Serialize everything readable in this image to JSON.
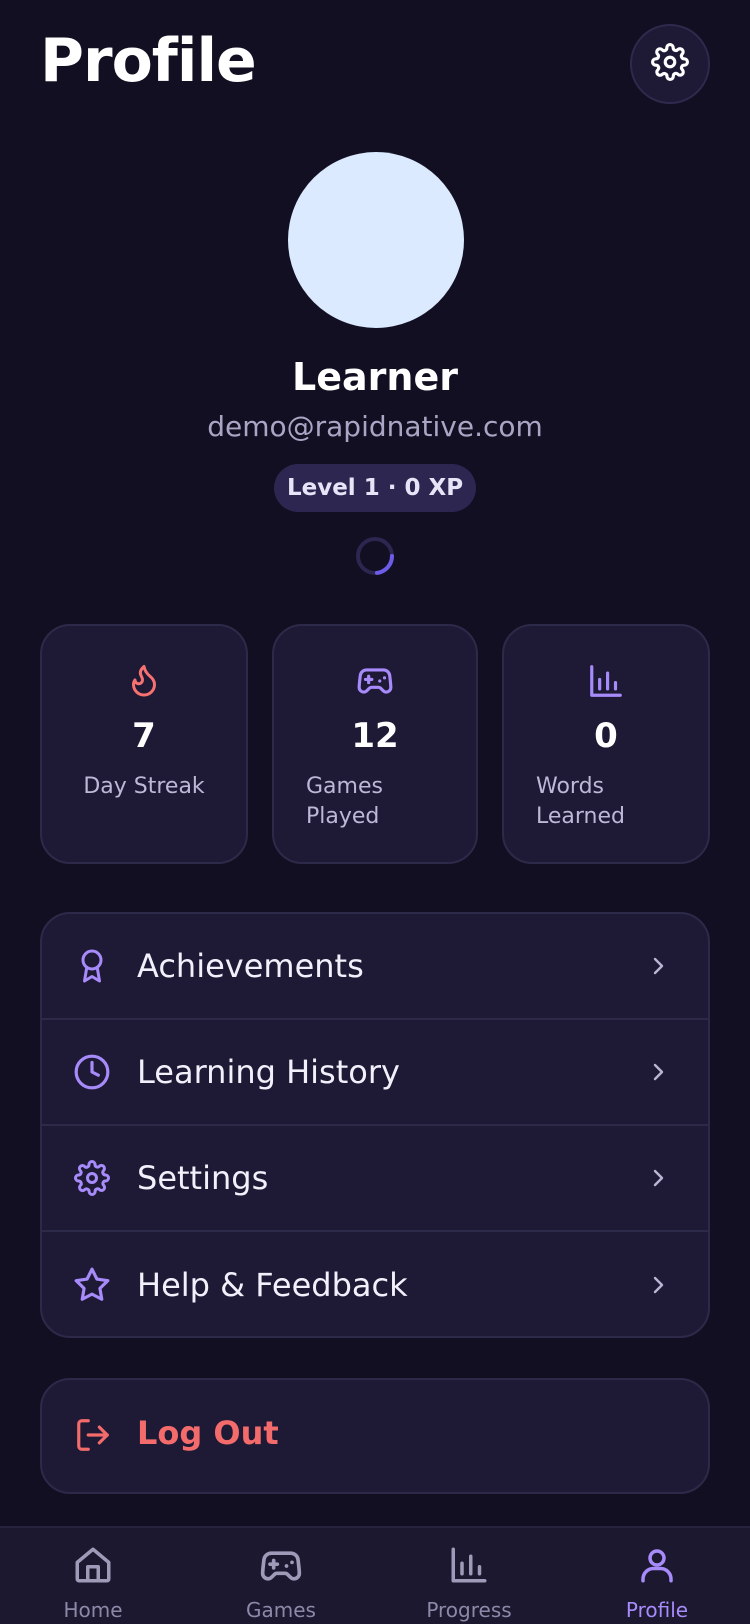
{
  "header": {
    "title": "Profile",
    "settings_icon": "gear-icon"
  },
  "profile": {
    "name": "Learner",
    "email": "demo@rapidnative.com",
    "level_badge": "Level 1 · 0 XP",
    "avatar_color": "#dbeafe"
  },
  "stats": [
    {
      "icon": "flame-icon",
      "value": "7",
      "label": "Day Streak",
      "icon_color": "#f87171"
    },
    {
      "icon": "gamepad-icon",
      "value": "12",
      "label": "Games Played",
      "icon_color": "#a78bfa"
    },
    {
      "icon": "bar-chart-icon",
      "value": "0",
      "label": "Words Learned",
      "icon_color": "#a78bfa"
    }
  ],
  "menu": [
    {
      "icon": "award-icon",
      "label": "Achievements"
    },
    {
      "icon": "clock-icon",
      "label": "Learning History"
    },
    {
      "icon": "gear-icon",
      "label": "Settings"
    },
    {
      "icon": "star-icon",
      "label": "Help & Feedback"
    }
  ],
  "logout": {
    "icon": "log-out-icon",
    "label": "Log Out",
    "color": "#f36b6b"
  },
  "tabs": [
    {
      "icon": "home-icon",
      "label": "Home",
      "active": false
    },
    {
      "icon": "gamepad-icon",
      "label": "Games",
      "active": false
    },
    {
      "icon": "bar-chart-icon",
      "label": "Progress",
      "active": false
    },
    {
      "icon": "user-icon",
      "label": "Profile",
      "active": true
    }
  ],
  "colors": {
    "background": "#110f21",
    "card": "#1e1a36",
    "accent": "#a78bfa",
    "danger": "#f36b6b"
  }
}
